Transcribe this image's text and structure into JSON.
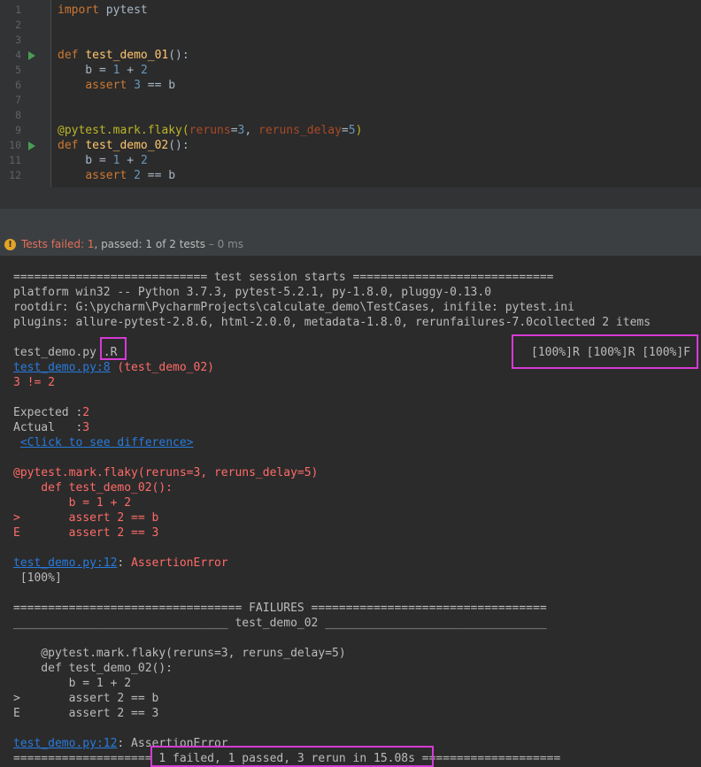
{
  "editor": {
    "lines": [
      {
        "no": "1",
        "parts": [
          {
            "t": "import",
            "c": "kw"
          },
          {
            "t": " pytest",
            "c": "plain"
          }
        ]
      },
      {
        "no": "2",
        "parts": []
      },
      {
        "no": "3",
        "parts": []
      },
      {
        "no": "4",
        "run": true,
        "parts": [
          {
            "t": "def",
            "c": "kw"
          },
          {
            "t": " ",
            "c": "plain"
          },
          {
            "t": "test_demo_01",
            "c": "fn"
          },
          {
            "t": "():",
            "c": "plain"
          }
        ]
      },
      {
        "no": "5",
        "parts": [
          {
            "t": "    b = ",
            "c": "plain"
          },
          {
            "t": "1",
            "c": "num"
          },
          {
            "t": " + ",
            "c": "plain"
          },
          {
            "t": "2",
            "c": "num"
          }
        ]
      },
      {
        "no": "6",
        "parts": [
          {
            "t": "    ",
            "c": "plain"
          },
          {
            "t": "assert",
            "c": "kw"
          },
          {
            "t": " ",
            "c": "plain"
          },
          {
            "t": "3",
            "c": "num"
          },
          {
            "t": " == b",
            "c": "plain"
          }
        ]
      },
      {
        "no": "7",
        "parts": []
      },
      {
        "no": "8",
        "parts": []
      },
      {
        "no": "9",
        "parts": [
          {
            "t": "@pytest.mark.flaky(",
            "c": "deco"
          },
          {
            "t": "reruns",
            "c": "param"
          },
          {
            "t": "=",
            "c": "plain"
          },
          {
            "t": "3",
            "c": "num"
          },
          {
            "t": ", ",
            "c": "plain"
          },
          {
            "t": "reruns_delay",
            "c": "param"
          },
          {
            "t": "=",
            "c": "plain"
          },
          {
            "t": "5",
            "c": "num"
          },
          {
            "t": ")",
            "c": "deco"
          }
        ]
      },
      {
        "no": "10",
        "run": true,
        "parts": [
          {
            "t": "def",
            "c": "kw"
          },
          {
            "t": " ",
            "c": "plain"
          },
          {
            "t": "test_demo_02",
            "c": "fn"
          },
          {
            "t": "():",
            "c": "plain"
          }
        ]
      },
      {
        "no": "11",
        "parts": [
          {
            "t": "    b = ",
            "c": "plain"
          },
          {
            "t": "1",
            "c": "num"
          },
          {
            "t": " + ",
            "c": "plain"
          },
          {
            "t": "2",
            "c": "num"
          }
        ]
      },
      {
        "no": "12",
        "parts": [
          {
            "t": "    ",
            "c": "plain"
          },
          {
            "t": "assert",
            "c": "kw"
          },
          {
            "t": " ",
            "c": "plain"
          },
          {
            "t": "2",
            "c": "num"
          },
          {
            "t": " == b",
            "c": "plain"
          }
        ]
      }
    ]
  },
  "status": {
    "failed_label": "Tests failed: 1",
    "passed_label": ", passed: 1",
    "of_label": " of 2 tests",
    "time_label": " – 0 ms"
  },
  "console": {
    "lines": [
      {
        "parts": [
          {
            "t": "============================ test session starts =============================",
            "c": ""
          }
        ]
      },
      {
        "parts": [
          {
            "t": "platform win32 -- Python 3.7.3, pytest-5.2.1, py-1.8.0, pluggy-0.13.0",
            "c": ""
          }
        ]
      },
      {
        "parts": [
          {
            "t": "rootdir: G:\\pycharm\\PycharmProjects\\calculate_demo\\TestCases, inifile: pytest.ini",
            "c": ""
          }
        ]
      },
      {
        "parts": [
          {
            "t": "plugins: allure-pytest-2.8.6, html-2.0.0, metadata-1.8.0, rerunfailures-7.0collected 2 items",
            "c": ""
          }
        ]
      },
      {
        "parts": []
      },
      {
        "parts": [
          {
            "t": "test_demo.py ",
            "c": ""
          },
          {
            "t": ".R",
            "c": ""
          }
        ],
        "right": "[100%]R [100%]R [100%]F"
      },
      {
        "parts": [
          {
            "t": "test_demo.py:8",
            "c": "link"
          },
          {
            "t": " (test_demo_02)",
            "c": "red"
          }
        ]
      },
      {
        "parts": [
          {
            "t": "3 != 2",
            "c": "red"
          }
        ]
      },
      {
        "parts": []
      },
      {
        "parts": [
          {
            "t": "Expected :",
            "c": ""
          },
          {
            "t": "2",
            "c": "red"
          }
        ]
      },
      {
        "parts": [
          {
            "t": "Actual   :",
            "c": ""
          },
          {
            "t": "3",
            "c": "red"
          }
        ]
      },
      {
        "parts": [
          {
            "t": " ",
            "c": ""
          },
          {
            "t": "<Click to see difference>",
            "c": "link"
          }
        ]
      },
      {
        "parts": []
      },
      {
        "parts": [
          {
            "t": "@pytest.mark.flaky(reruns=3, reruns_delay=5)",
            "c": "red"
          }
        ]
      },
      {
        "parts": [
          {
            "t": "    def test_demo_02():",
            "c": "red"
          }
        ]
      },
      {
        "parts": [
          {
            "t": "        b = 1 + 2",
            "c": "red"
          }
        ]
      },
      {
        "parts": [
          {
            "t": ">       assert 2 == b",
            "c": "red"
          }
        ]
      },
      {
        "parts": [
          {
            "t": "E       assert 2 == 3",
            "c": "red"
          }
        ]
      },
      {
        "parts": []
      },
      {
        "parts": [
          {
            "t": "test_demo.py:12",
            "c": "link"
          },
          {
            "t": ": ",
            "c": ""
          },
          {
            "t": "AssertionError",
            "c": "red"
          }
        ]
      },
      {
        "parts": [
          {
            "t": " [100%]",
            "c": ""
          }
        ]
      },
      {
        "parts": []
      },
      {
        "parts": [
          {
            "t": "================================= FAILURES ==================================",
            "c": ""
          }
        ]
      },
      {
        "parts": [
          {
            "t": "_______________________________ test_demo_02 ________________________________",
            "c": ""
          }
        ]
      },
      {
        "parts": []
      },
      {
        "parts": [
          {
            "t": "    @pytest.mark.flaky(reruns=3, reruns_delay=5)",
            "c": ""
          }
        ]
      },
      {
        "parts": [
          {
            "t": "    def test_demo_02():",
            "c": ""
          }
        ]
      },
      {
        "parts": [
          {
            "t": "        b = 1 + 2",
            "c": ""
          }
        ]
      },
      {
        "parts": [
          {
            "t": ">       assert 2 == b",
            "c": ""
          }
        ]
      },
      {
        "parts": [
          {
            "t": "E       assert 2 == 3",
            "c": ""
          }
        ]
      },
      {
        "parts": []
      },
      {
        "parts": [
          {
            "t": "test_demo.py:12",
            "c": "link"
          },
          {
            "t": ": AssertionError",
            "c": ""
          }
        ]
      },
      {
        "parts": [
          {
            "t": "==================== 1 failed, 1 passed, 3 rerun in 15.08s ====================",
            "c": ""
          }
        ]
      }
    ]
  },
  "highlight_color": "#d63ad6"
}
